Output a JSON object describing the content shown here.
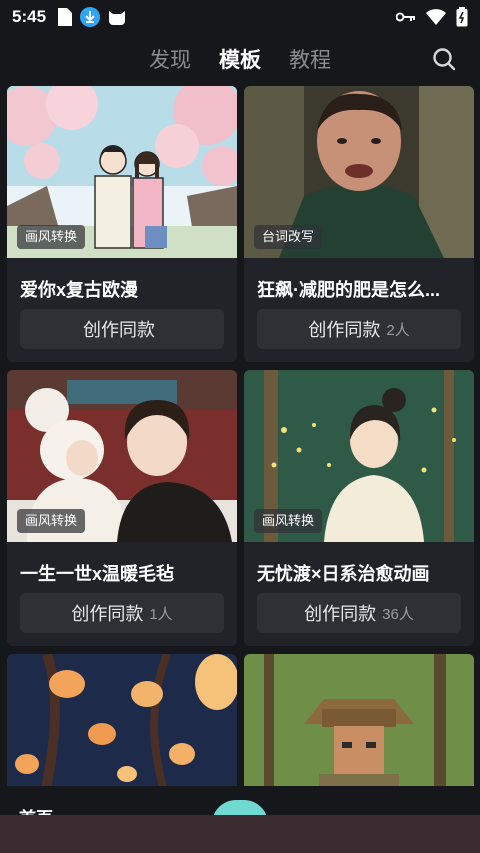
{
  "status_bar": {
    "time": "5:45",
    "left_icons": [
      "sim-card-icon",
      "download-icon",
      "cat-icon"
    ],
    "right_icons": [
      "key-icon",
      "wifi-icon",
      "battery-icon"
    ]
  },
  "tabs": [
    {
      "label": "发现",
      "active": false
    },
    {
      "label": "模板",
      "active": true
    },
    {
      "label": "教程",
      "active": false
    }
  ],
  "search_icon": "search-icon",
  "cards": [
    {
      "badge": "画风转换",
      "title": "爱你x复古欧漫",
      "button": "创作同款",
      "count": ""
    },
    {
      "badge": "台词改写",
      "title": "狂飙·减肥的肥是怎么...",
      "button": "创作同款",
      "count": "2人"
    },
    {
      "badge": "画风转换",
      "title": "一生一世x温暖毛毡",
      "button": "创作同款",
      "count": "1人"
    },
    {
      "badge": "画风转换",
      "title": "无忧渡×日系治愈动画",
      "button": "创作同款",
      "count": "36人"
    },
    {
      "badge": "",
      "title": "",
      "button": "",
      "count": ""
    },
    {
      "badge": "",
      "title": "",
      "button": "",
      "count": ""
    }
  ],
  "bottom_nav": {
    "home_label": "首页"
  },
  "colors": {
    "background": "#16171b",
    "card": "#222328",
    "button": "#2f3035",
    "accent": "#6fd9d2"
  }
}
